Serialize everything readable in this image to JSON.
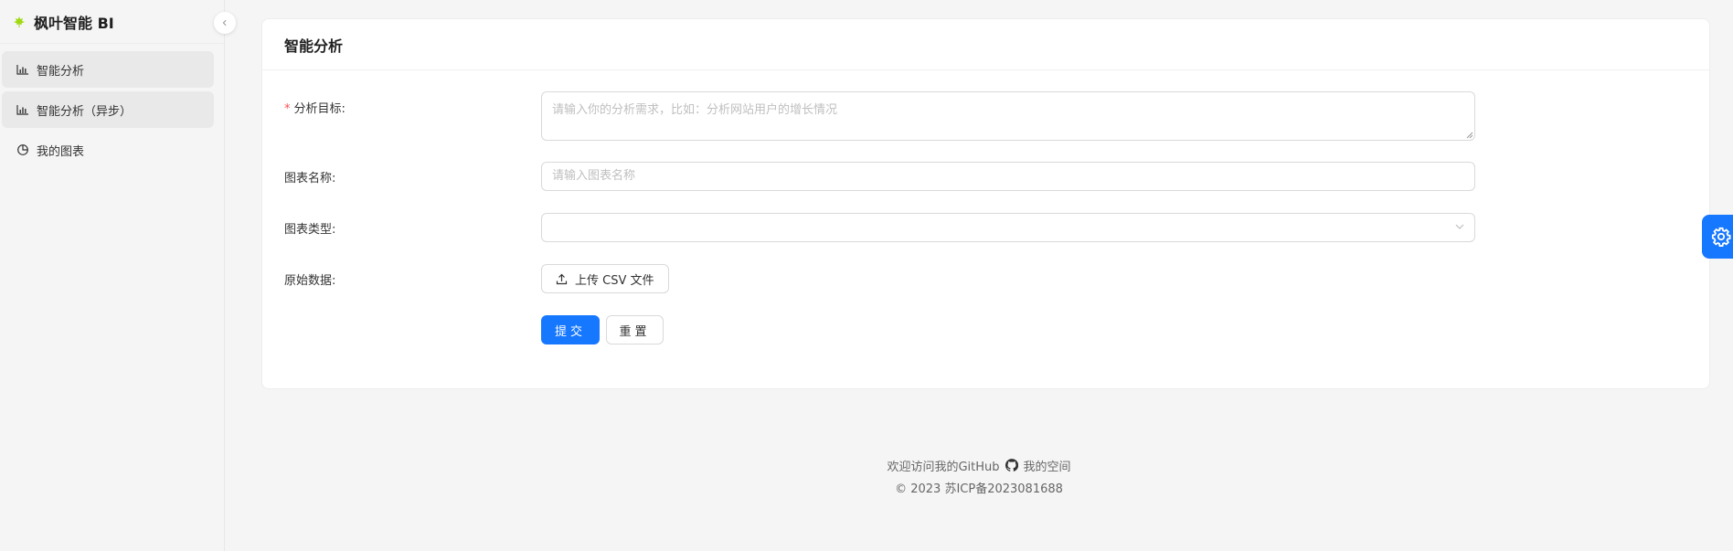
{
  "app": {
    "title": "枫叶智能 BI"
  },
  "sidebar": {
    "items": [
      {
        "label": "智能分析",
        "icon": "bar-chart-icon",
        "selected": true
      },
      {
        "label": "智能分析（异步）",
        "icon": "bar-chart-icon",
        "selected": true
      },
      {
        "label": "我的图表",
        "icon": "pie-chart-icon",
        "selected": false
      }
    ]
  },
  "card": {
    "title": "智能分析"
  },
  "form": {
    "goal": {
      "required_mark": "*",
      "label": "分析目标:",
      "placeholder": "请输入你的分析需求，比如：分析网站用户的增长情况"
    },
    "name": {
      "label": "图表名称:",
      "placeholder": "请输入图表名称"
    },
    "type": {
      "label": "图表类型:",
      "value": ""
    },
    "data": {
      "label": "原始数据:",
      "upload_label": "上传 CSV 文件"
    },
    "submit_label": "提交",
    "reset_label": "重置"
  },
  "footer": {
    "welcome_text": "欢迎访问我的GitHub",
    "space_text": "我的空间",
    "copyright": "© 2023 苏ICP备2023081688"
  },
  "colors": {
    "primary": "#1677ff",
    "logo": "#a0d911",
    "required": "#ff4d4f"
  }
}
